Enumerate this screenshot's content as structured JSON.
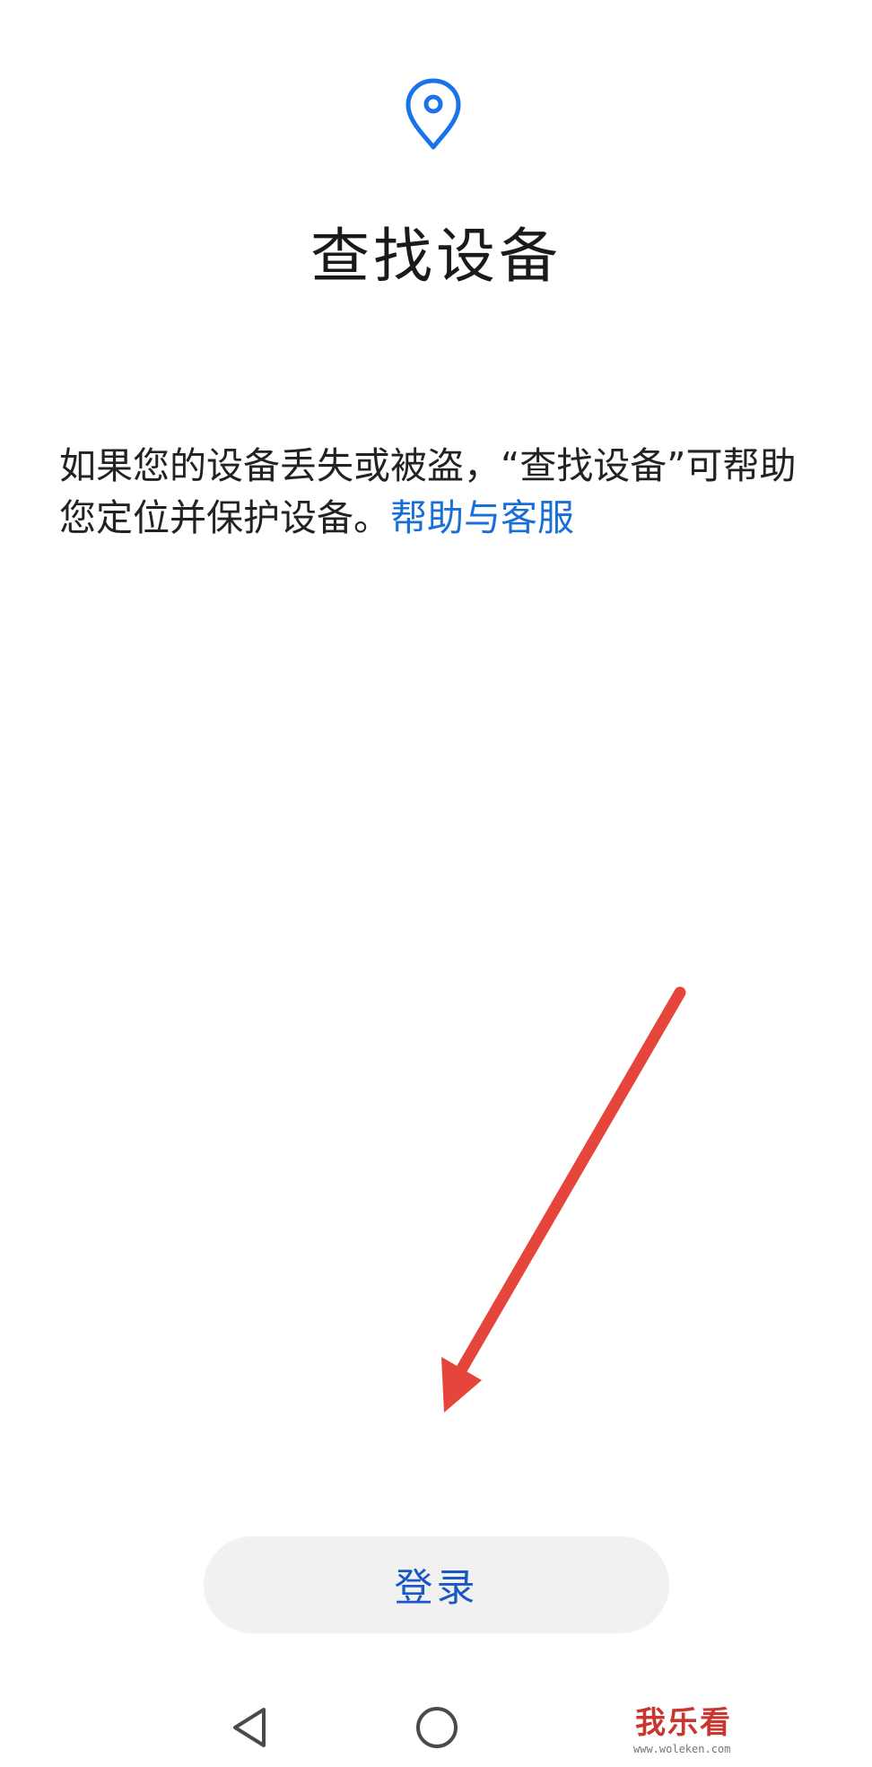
{
  "icons": {
    "location": "location-pin-icon",
    "back": "back-triangle-icon",
    "home": "home-circle-icon"
  },
  "colors": {
    "accent": "#1a6fd6",
    "button_text": "#1a58c4",
    "button_bg": "#f1f1f1",
    "annotation_arrow": "#e5453a",
    "watermark": "#c93630"
  },
  "page": {
    "title": "查找设备",
    "description": "如果您的设备丢失或被盗，“查找设备”可帮助您定位并保护设备。",
    "help_link": "帮助与客服"
  },
  "actions": {
    "login_label": "登录"
  },
  "watermark": {
    "text": "我乐看",
    "url": "www.woleken.com"
  }
}
